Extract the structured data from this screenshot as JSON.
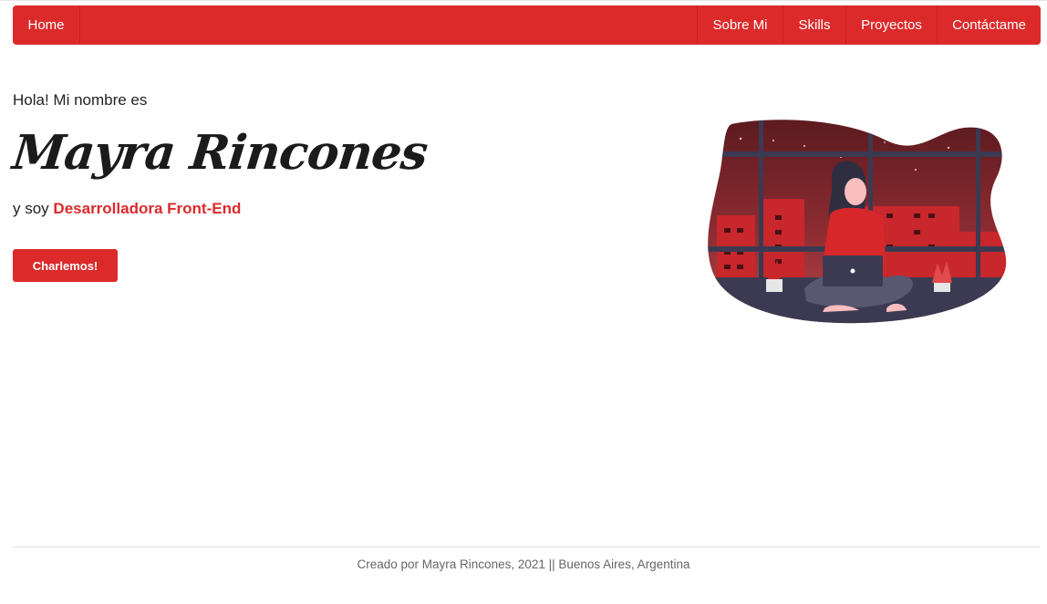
{
  "nav": {
    "home": "Home",
    "items": [
      "Sobre Mi",
      "Skills",
      "Proyectos",
      "Contáctame"
    ]
  },
  "hero": {
    "greeting": "Hola! Mi nombre es",
    "name": "Mayra Rincones",
    "role_prefix": "y soy",
    "role": "Desarrolladora Front-End",
    "cta": "Charlemos!",
    "illustration": "woman-with-laptop-illustration"
  },
  "footer": {
    "text": "Creado por Mayra Rincones, 2021 || Buenos Aires, Argentina"
  },
  "colors": {
    "brand": "#dc2a2b",
    "text": "#222222",
    "footer_text": "#666666"
  }
}
